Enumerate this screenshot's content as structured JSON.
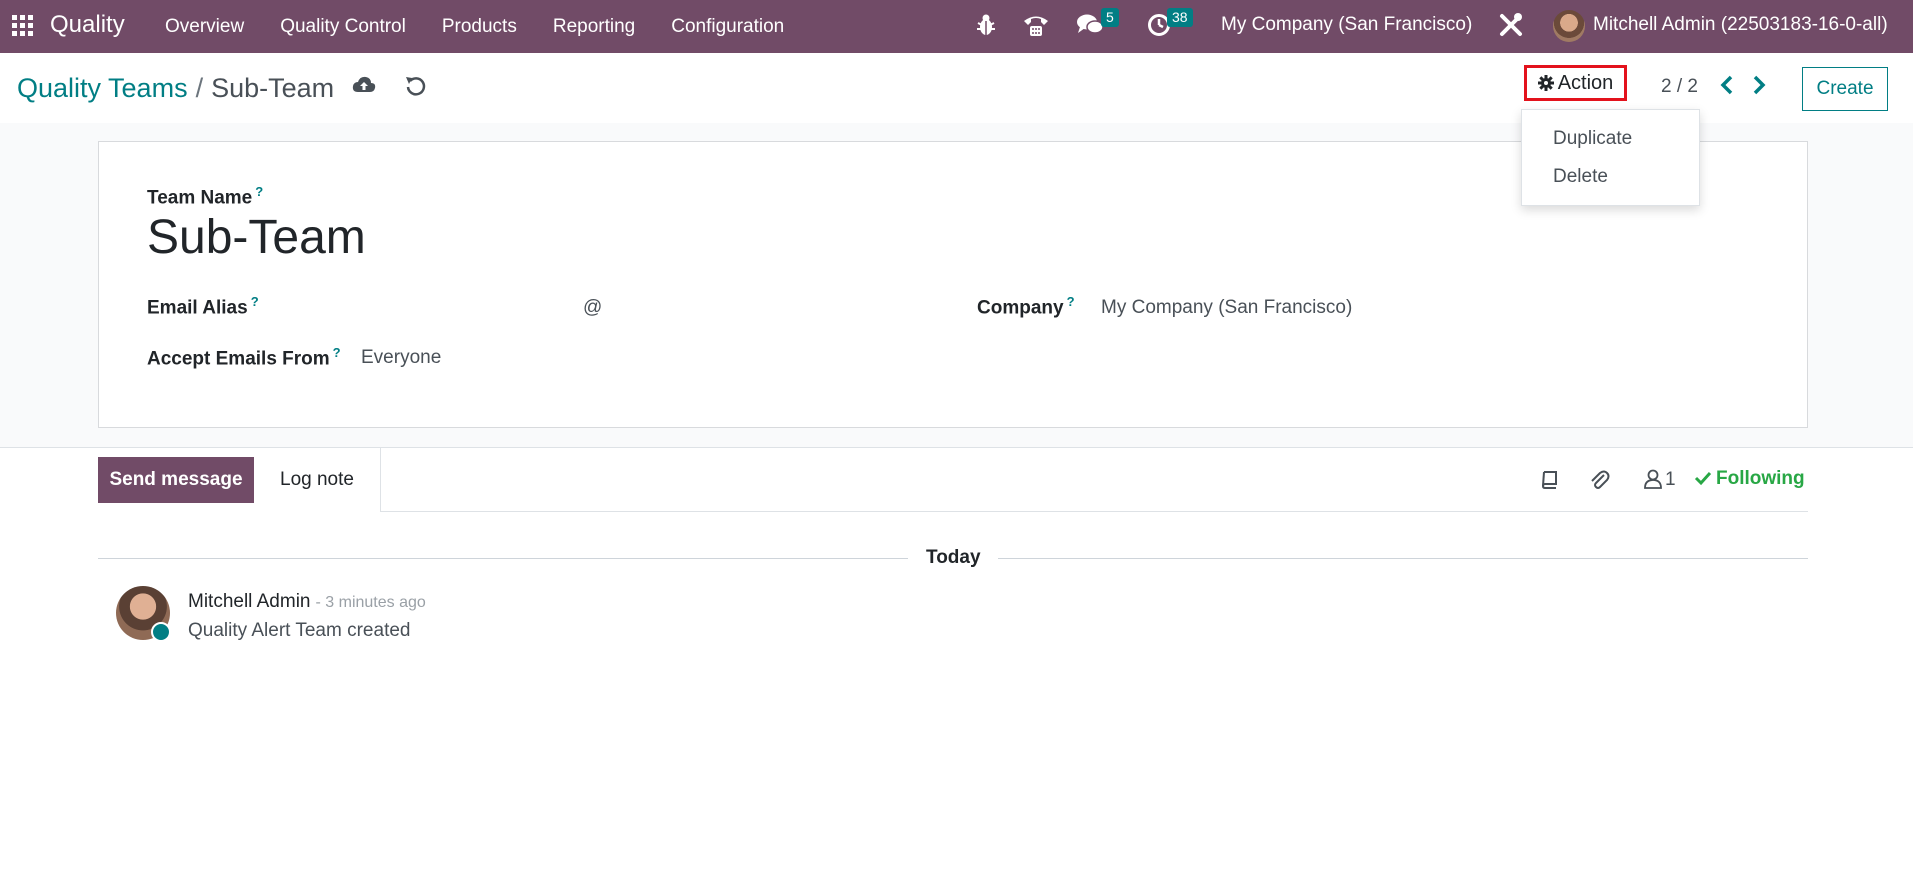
{
  "navbar": {
    "brand": "Quality",
    "menu": [
      "Overview",
      "Quality Control",
      "Products",
      "Reporting",
      "Configuration"
    ],
    "messages_badge": "5",
    "activities_badge": "38",
    "company": "My Company (San Francisco)",
    "user": "Mitchell Admin (22503183-16-0-all)"
  },
  "control": {
    "breadcrumb_parent": "Quality Teams",
    "breadcrumb_separator": "/",
    "breadcrumb_current": "Sub-Team",
    "action_label": "Action",
    "pager": "2 / 2",
    "create_label": "Create",
    "action_menu": [
      "Duplicate",
      "Delete"
    ]
  },
  "form": {
    "team_name_label": "Team Name",
    "team_name": "Sub-Team",
    "email_alias_label": "Email Alias",
    "email_alias_at": "@",
    "accept_emails_label": "Accept Emails From",
    "accept_emails_value": "Everyone",
    "company_label": "Company",
    "company_value": "My Company (San Francisco)",
    "help_mark": "?"
  },
  "chatter": {
    "send_message": "Send message",
    "log_note": "Log note",
    "followers_count": "1",
    "following": "Following",
    "date_separator": "Today",
    "message": {
      "author": "Mitchell Admin",
      "time": "- 3 minutes ago",
      "body": "Quality Alert Team created"
    }
  },
  "colors": {
    "brand": "#714B67",
    "accent": "#017E84",
    "highlight": "#e3121c",
    "following": "#28a745"
  }
}
